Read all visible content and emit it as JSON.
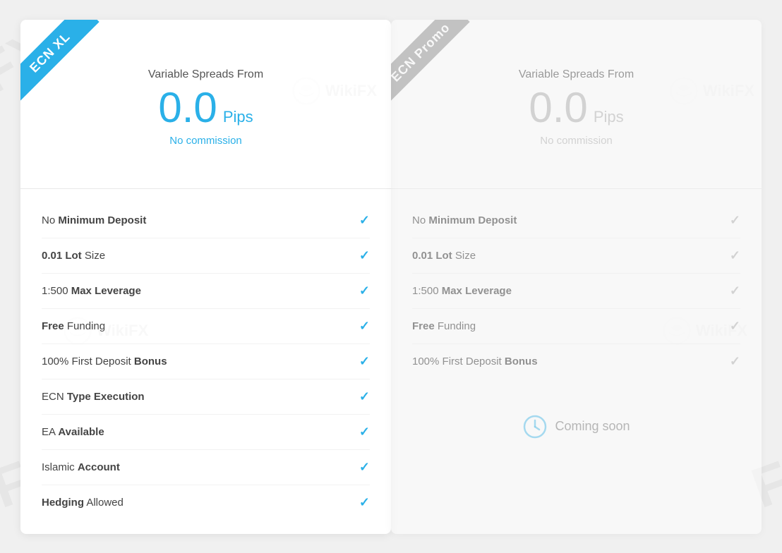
{
  "watermarks": {
    "fx1": "FX",
    "wikifx1": "WikiFX",
    "fx2": "FX",
    "wikifx2": "WikiFX",
    "fx3": "FX"
  },
  "cards": [
    {
      "id": "ecn-xl",
      "ribbon_label": "ECN XL",
      "ribbon_type": "blue",
      "spreads_from_label": "Variable Spreads From",
      "pips_value": "0.0",
      "pips_unit": "Pips",
      "commission_label": "No commission",
      "color": "blue",
      "features": [
        {
          "prefix": "No ",
          "bold": "Minimum Deposit",
          "suffix": "",
          "checked": true
        },
        {
          "prefix": "",
          "bold": "0.01 Lot",
          "suffix": " Size",
          "checked": true
        },
        {
          "prefix": "1:500 ",
          "bold": "Max Leverage",
          "suffix": "",
          "checked": true
        },
        {
          "prefix": "",
          "bold": "Free",
          "suffix": " Funding",
          "checked": true
        },
        {
          "prefix": "100% First Deposit ",
          "bold": "Bonus",
          "suffix": "",
          "checked": true
        },
        {
          "prefix": "ECN ",
          "bold": "Type Execution",
          "suffix": "",
          "checked": true
        },
        {
          "prefix": "EA ",
          "bold": "Available",
          "suffix": "",
          "checked": true
        },
        {
          "prefix": "Islamic ",
          "bold": "Account",
          "suffix": "",
          "checked": true
        },
        {
          "prefix": "",
          "bold": "Hedging",
          "suffix": " Allowed",
          "checked": true
        }
      ],
      "coming_soon": false
    },
    {
      "id": "ecn-promo",
      "ribbon_label": "ECN Promo",
      "ribbon_type": "gray",
      "spreads_from_label": "Variable Spreads From",
      "pips_value": "0.0",
      "pips_unit": "Pips",
      "commission_label": "No commission",
      "color": "gray",
      "features": [
        {
          "prefix": "No ",
          "bold": "Minimum Deposit",
          "suffix": "",
          "checked": true
        },
        {
          "prefix": "",
          "bold": "0.01 Lot",
          "suffix": " Size",
          "checked": true
        },
        {
          "prefix": "1:500 ",
          "bold": "Max Leverage",
          "suffix": "",
          "checked": true
        },
        {
          "prefix": "",
          "bold": "Free",
          "suffix": " Funding",
          "checked": true
        },
        {
          "prefix": "100% First Deposit ",
          "bold": "Bonus",
          "suffix": "",
          "checked": true
        }
      ],
      "coming_soon": true,
      "coming_soon_label": "Coming soon"
    }
  ]
}
